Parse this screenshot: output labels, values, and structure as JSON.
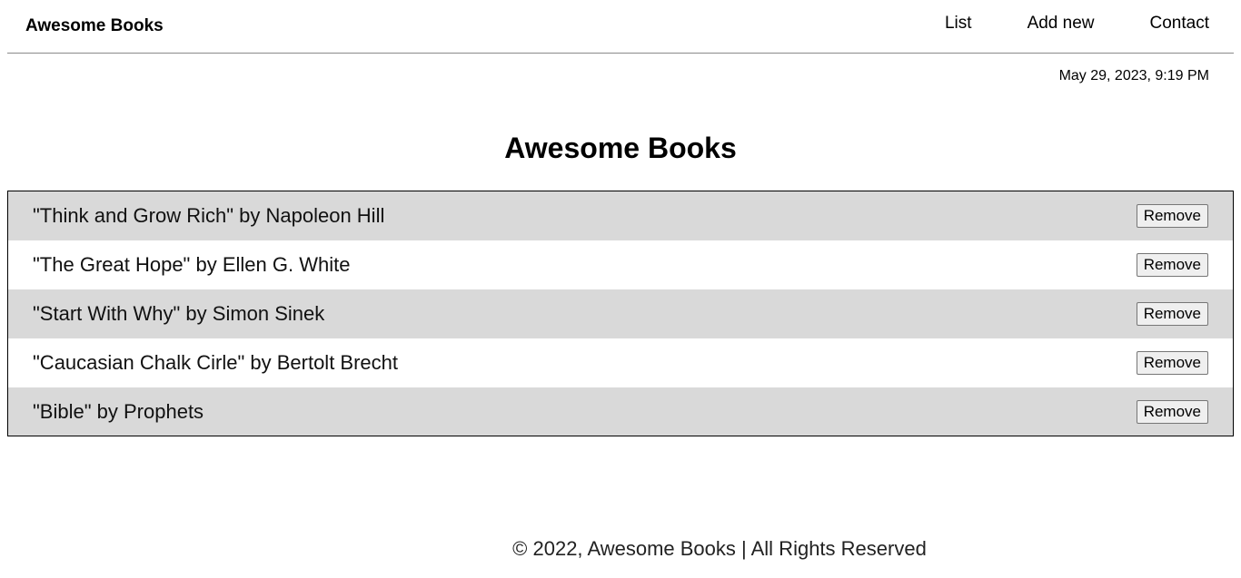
{
  "navbar": {
    "brand": "Awesome Books",
    "links": [
      "List",
      "Add new",
      "Contact"
    ]
  },
  "datetime": "May 29, 2023, 9:19 PM",
  "main": {
    "title": "Awesome Books",
    "books": [
      {
        "text": "\"Think and Grow Rich\" by Napoleon Hill",
        "button": "Remove"
      },
      {
        "text": "\"The Great Hope\" by Ellen G. White",
        "button": "Remove"
      },
      {
        "text": "\"Start With Why\" by Simon Sinek",
        "button": "Remove"
      },
      {
        "text": "\"Caucasian Chalk Cirle\" by Bertolt Brecht",
        "button": "Remove"
      },
      {
        "text": "\"Bible\" by Prophets",
        "button": "Remove"
      }
    ]
  },
  "footer": {
    "text": "© 2022, Awesome Books | All Rights Reserved"
  },
  "colors": {
    "row_alt": "#d9d9d9",
    "row": "#ffffff",
    "divider": "#8a8a8a"
  }
}
